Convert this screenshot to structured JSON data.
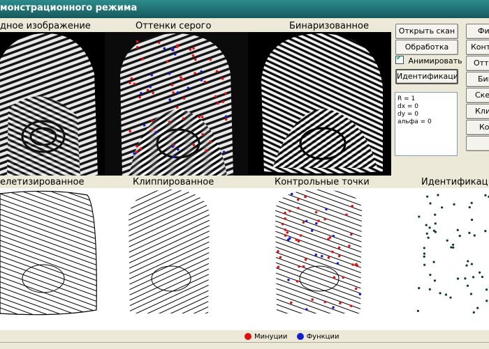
{
  "window": {
    "title": "монстрационного режима"
  },
  "panels": {
    "top": [
      {
        "label": "дное изображение"
      },
      {
        "label": "Оттенки серого"
      },
      {
        "label": "Бинаризованное"
      }
    ],
    "bottom": [
      {
        "label": "елетизированное"
      },
      {
        "label": "Клиппированное"
      },
      {
        "label": "Контрольные точки"
      },
      {
        "label": "Идентификац"
      }
    ]
  },
  "controls": {
    "open_scan": "Открыть скан",
    "processing": "Обработка",
    "animate_label": "Анимировать",
    "animate_checked": true,
    "identify": "Идентификация"
  },
  "right_buttons": [
    "Фи",
    "Контра",
    "Отте",
    "Бин",
    "Скел",
    "Клип",
    "Ко",
    ""
  ],
  "info": [
    "R = 1",
    "dx = 0",
    "dy = 0",
    "альфа = 0"
  ],
  "legend": {
    "minutiae": "Минуции",
    "functions": "Функции",
    "minutiae_color": "#E01010",
    "functions_color": "#1020D0"
  }
}
